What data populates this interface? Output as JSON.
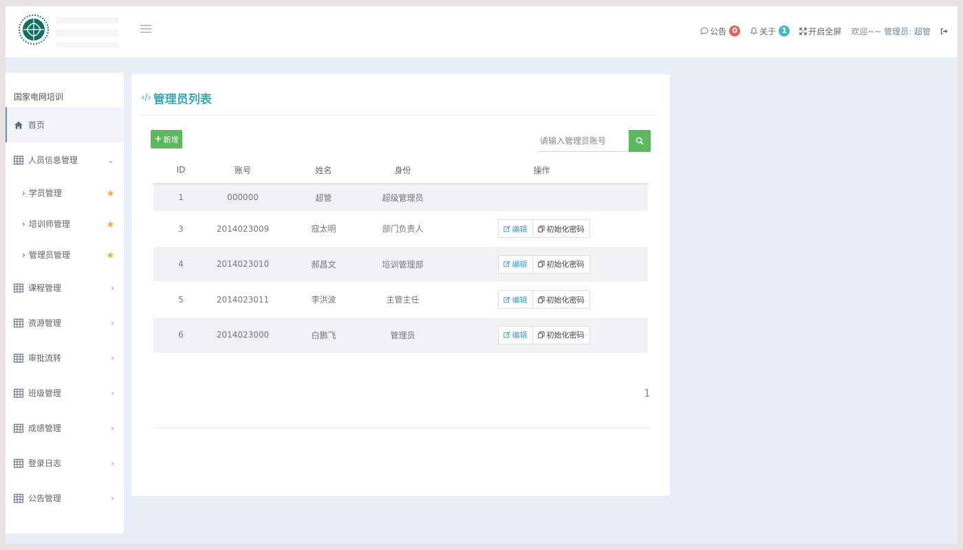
{
  "header": {
    "notice_label": "公告",
    "notice_count": "0",
    "about_label": "关于",
    "about_count": "1",
    "fullscreen_label": "开启全屏",
    "welcome_text": "欢迎~~ 管理员: 超管"
  },
  "sidebar": {
    "title": "国家电网培训",
    "home_label": "首页",
    "group_people": "人员信息管理",
    "sub_items": [
      {
        "label": "学员管理"
      },
      {
        "label": "培训师管理"
      },
      {
        "label": "管理员管理"
      }
    ],
    "items": [
      {
        "label": "课程管理"
      },
      {
        "label": "资源管理"
      },
      {
        "label": "审批流转"
      },
      {
        "label": "班级管理"
      },
      {
        "label": "成绩管理"
      },
      {
        "label": "登录日志"
      },
      {
        "label": "公告管理"
      }
    ]
  },
  "main": {
    "title": "管理员列表",
    "add_label": "新增",
    "search_placeholder": "请输入管理员账号",
    "columns": [
      "ID",
      "账号",
      "姓名",
      "身份",
      "操作"
    ],
    "rows": [
      {
        "id": "1",
        "account": "000000",
        "name": "超管",
        "role": "超级管理员"
      },
      {
        "id": "3",
        "account": "2014023009",
        "name": "寇太明",
        "role": "部门负责人"
      },
      {
        "id": "4",
        "account": "2014023010",
        "name": "郝昌文",
        "role": "培训管理部"
      },
      {
        "id": "5",
        "account": "2014023011",
        "name": "李洪波",
        "role": "主管主任"
      },
      {
        "id": "6",
        "account": "2014023000",
        "name": "白鹏飞",
        "role": "管理员"
      }
    ],
    "edit_label": "编辑",
    "reset_label": "初始化密码",
    "page": "1"
  },
  "colors": {
    "accent": "#3aa8b4",
    "success": "#5cb85c",
    "badge_red": "#e8605e",
    "badge_teal": "#3dbbc9",
    "star": "#f0ad4e"
  }
}
